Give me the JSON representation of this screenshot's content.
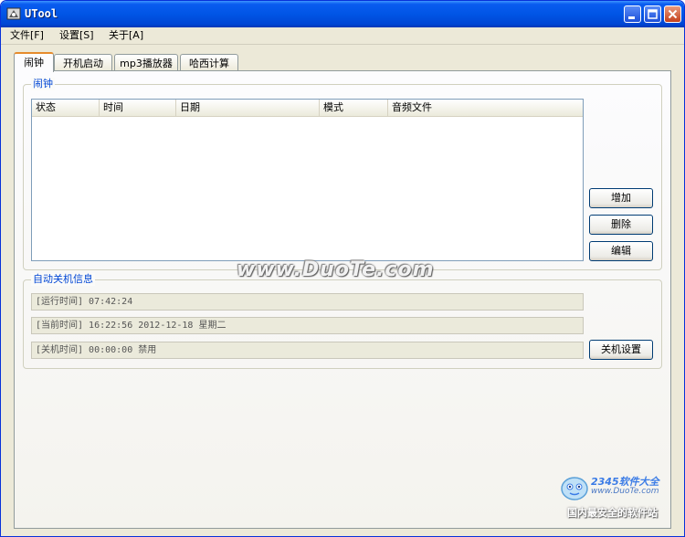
{
  "window": {
    "title": "UTool"
  },
  "menubar": {
    "items": [
      "文件[F]",
      "设置[S]",
      "关于[A]"
    ]
  },
  "tabs": [
    {
      "label": "闹钟",
      "active": true
    },
    {
      "label": "开机启动",
      "active": false
    },
    {
      "label": "mp3播放器",
      "active": false
    },
    {
      "label": "哈西计算",
      "active": false
    }
  ],
  "alarm": {
    "group_title": "闹钟",
    "columns": [
      "状态",
      "时间",
      "日期",
      "模式",
      "音频文件"
    ],
    "rows": [],
    "buttons": {
      "add": "增加",
      "delete": "删除",
      "edit": "编辑"
    }
  },
  "shutdown": {
    "group_title": "自动关机信息",
    "run_time": "[运行时间] 07:42:24",
    "current_time": "[当前时间] 16:22:56 2012-12-18 星期二",
    "shutdown_time": "[关机时间] 00:00:00 禁用",
    "settings_button": "关机设置"
  },
  "watermark": "www.DuoTe.com",
  "logo": {
    "brand": "2345软件大全",
    "url": "www.DuoTe.com",
    "slogan": "国内最安全的软件站"
  },
  "colors": {
    "titlebar": "#0055e5",
    "tab_accent": "#e68b2c",
    "group_title": "#0046d5"
  }
}
